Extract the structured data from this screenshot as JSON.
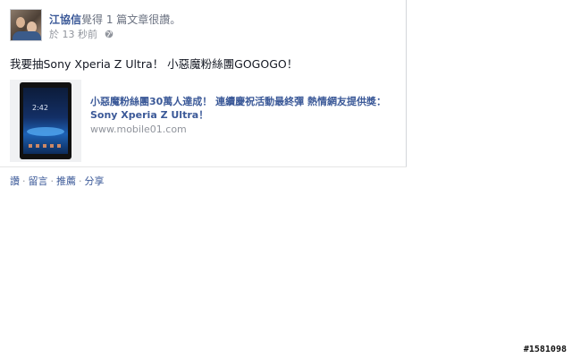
{
  "post": {
    "author": "江協信",
    "activity": "覺得 1 篇文章很讚。",
    "time": "於 13 秒前",
    "privacy_icon": "globe-icon",
    "message": "我要抽Sony Xperia Z Ultra！ 小惡魔粉絲團GOGOGO！",
    "link": {
      "title": "小惡魔粉絲團30萬人達成！ 連續慶祝活動最終彈 熱情網友提供獎：Sony Xperia Z Ultra！",
      "domain": "www.mobile01.com",
      "thumbnail_clock": "2:42"
    },
    "actions": [
      "讚",
      "留言",
      "推薦",
      "分享"
    ]
  },
  "watermark": "#1581098",
  "colors": {
    "link_blue": "#3b5998",
    "meta_gray": "#90949c"
  }
}
